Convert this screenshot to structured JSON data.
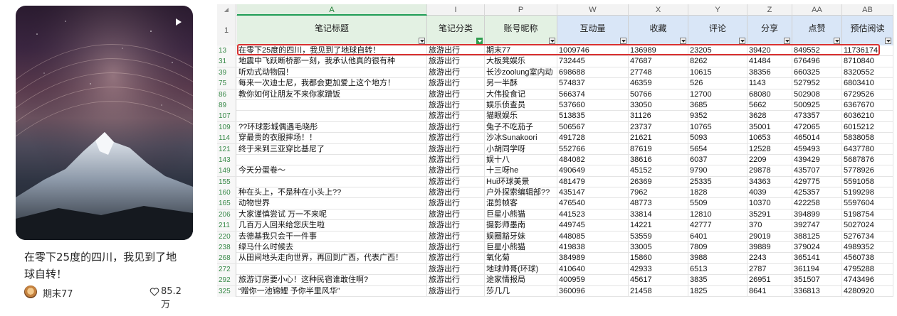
{
  "card": {
    "title": "在零下25度的四川，我见到了地球自转！",
    "author": "期末77",
    "likes": "85.2万",
    "play_icon": "play-icon",
    "heart_icon": "heart-icon"
  },
  "sheet": {
    "corner": "◢",
    "columns": [
      {
        "letter": "A",
        "header": "笔记标题"
      },
      {
        "letter": "I",
        "header": "笔记分类"
      },
      {
        "letter": "P",
        "header": "账号昵称"
      },
      {
        "letter": "W",
        "header": "互动量"
      },
      {
        "letter": "X",
        "header": "收藏"
      },
      {
        "letter": "Y",
        "header": "评论"
      },
      {
        "letter": "Z",
        "header": "分享"
      },
      {
        "letter": "AA",
        "header": "点赞"
      },
      {
        "letter": "AB",
        "header": "预估阅读"
      }
    ],
    "header_row_number": "1",
    "rows": [
      [
        "13",
        "在零下25度的四川，我见到了地球自转！",
        "旅游出行",
        "期末77",
        "1009746",
        "136989",
        "23205",
        "39420",
        "849552",
        "11736174"
      ],
      [
        "31",
        "地震中飞跃断桥那一刻，我承认他真的很有种",
        "旅游出行",
        "大板凳娱乐",
        "732445",
        "47687",
        "8262",
        "41484",
        "676496",
        "8710840"
      ],
      [
        "39",
        "听劝式动物园！",
        "旅游出行",
        "长沙zoolung室内动",
        "698688",
        "27748",
        "10615",
        "38356",
        "660325",
        "8320552"
      ],
      [
        "75",
        "每来一次迪士尼，我都会更加爱上这个地方！",
        "旅游出行",
        "另一半酥",
        "574837",
        "46359",
        "526",
        "1143",
        "527952",
        "6803410"
      ],
      [
        "86",
        "教你如何让朋友不来你家蹭饭",
        "旅游出行",
        "大伟投食记",
        "566374",
        "50766",
        "12700",
        "68080",
        "502908",
        "6729526"
      ],
      [
        "89",
        "",
        "旅游出行",
        "娱乐侦查员",
        "537660",
        "33050",
        "3685",
        "5662",
        "500925",
        "6367670"
      ],
      [
        "107",
        "",
        "旅游出行",
        "猫眼娱乐",
        "513835",
        "31126",
        "9352",
        "3628",
        "473357",
        "6036210"
      ],
      [
        "109",
        "??环球影城偶遇毛晓彤",
        "旅游出行",
        "兔子不吃茄子",
        "506567",
        "23737",
        "10765",
        "35001",
        "472065",
        "6015212"
      ],
      [
        "114",
        "穿最贵的衣服摔场！！",
        "旅游出行",
        "沙冰Sunakoori",
        "491728",
        "21621",
        "5093",
        "10653",
        "465014",
        "5838058"
      ],
      [
        "121",
        "终于来到三亚穿比基尼了",
        "旅游出行",
        "小胡同学呀",
        "552766",
        "87619",
        "5654",
        "12528",
        "459493",
        "6437780"
      ],
      [
        "143",
        "",
        "旅游出行",
        "娱十八",
        "484082",
        "38616",
        "6037",
        "2209",
        "439429",
        "5687876"
      ],
      [
        "149",
        "今天分蛋卷～",
        "旅游出行",
        "十三呀he",
        "490649",
        "45152",
        "9790",
        "29878",
        "435707",
        "5778926"
      ],
      [
        "155",
        "",
        "旅游出行",
        "Hui环球美景",
        "481479",
        "26369",
        "25335",
        "34363",
        "429775",
        "5591058"
      ],
      [
        "160",
        "种在头上，不是种在小头上??",
        "旅游出行",
        "户外探索编辑部??",
        "435147",
        "7962",
        "1828",
        "4039",
        "425357",
        "5199298"
      ],
      [
        "165",
        "动物世界",
        "旅游出行",
        "混剪帧客",
        "476540",
        "48773",
        "5509",
        "10370",
        "422258",
        "5597604"
      ],
      [
        "206",
        "大家谨慎尝试 万一不来呢",
        "旅游出行",
        "巨星小熊猫",
        "441523",
        "33814",
        "12810",
        "35291",
        "394899",
        "5198754"
      ],
      [
        "211",
        "几百万人回来给您庆生啦",
        "旅游出行",
        "摄影师墨南",
        "449745",
        "14221",
        "42777",
        "370",
        "392747",
        "5027024"
      ],
      [
        "220",
        "去德基我只会干一件事",
        "旅游出行",
        "娱圈豁牙妹",
        "448085",
        "53559",
        "6401",
        "29019",
        "388125",
        "5276734"
      ],
      [
        "238",
        "绿马什么时候去",
        "旅游出行",
        "巨星小熊猫",
        "419838",
        "33005",
        "7809",
        "39889",
        "379024",
        "4989352"
      ],
      [
        "268",
        "从田间地头走向世界，再回到广西，代表广西！",
        "旅游出行",
        "氧化菊",
        "384989",
        "15860",
        "3988",
        "2243",
        "365141",
        "4560738"
      ],
      [
        "272",
        "",
        "旅游出行",
        "地球帅哥(环球)",
        "410640",
        "42933",
        "6513",
        "2787",
        "361194",
        "4795288"
      ],
      [
        "292",
        "旅游订房要小心！这种民宿谁敢住啊?",
        "旅游出行",
        "途家情报局",
        "400959",
        "45617",
        "3835",
        "26951",
        "351507",
        "4743496"
      ],
      [
        "325",
        "“赠你一池锦鲤 予你半里风华”",
        "旅游出行",
        "莎几几",
        "360096",
        "21458",
        "1825",
        "8641",
        "336813",
        "4280920"
      ]
    ]
  }
}
